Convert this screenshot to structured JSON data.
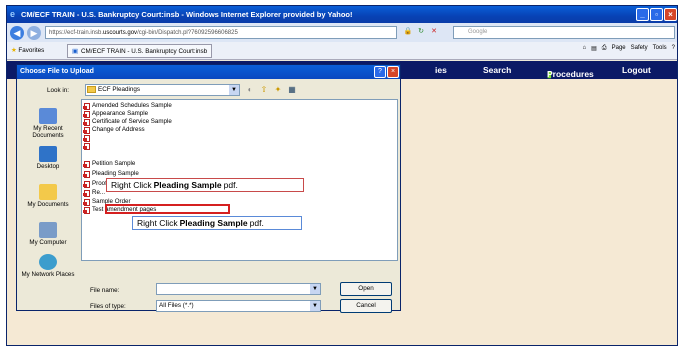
{
  "browser": {
    "title": "CM/ECF TRAIN - U.S. Bankruptcy Court:insb - Windows Internet Explorer provided by Yahoo!",
    "url_prefix": "https://ecf-train.insb.",
    "url_host": "uscourts.gov",
    "url_path": "/cgi-bin/Dispatch.pl?76092596606825",
    "search_placeholder": "Google",
    "favorites_label": "Favorites",
    "tab_label": "CM/ECF TRAIN - U.S. Bankruptcy Court:insb",
    "cmd_page": "Page",
    "cmd_safety": "Safety",
    "cmd_tools": "Tools"
  },
  "ecf_nav": {
    "items_label": "ies",
    "search": "Search",
    "procedures": "Procedures",
    "logout": "Logout"
  },
  "dialog": {
    "title": "Choose File to Upload",
    "look_in_label": "Look in:",
    "look_in_value": "ECF Pleadings",
    "places": [
      "My Recent Documents",
      "Desktop",
      "My Documents",
      "My Computer",
      "My Network Places"
    ],
    "files": [
      "Amended Schedules Sample",
      "Appearance Sample",
      "Certificate of Service Sample",
      "Change of Address",
      "",
      "",
      "Petition Sample",
      "Pleading Sample",
      "Proof of Claim Sample",
      "Re...",
      "Sample Order",
      "Test amendment pages"
    ],
    "file_name_label": "File name:",
    "file_name_value": "",
    "files_of_type_label": "Files of type:",
    "files_of_type_value": "All Files (*.*)",
    "open_button": "Open",
    "cancel_button": "Cancel"
  },
  "callouts": {
    "first_prefix": "Right Click",
    "first_bold": "Pleading Sample",
    "first_suffix": "pdf.",
    "second_prefix": "Right Click",
    "second_bold": "Pleading Sample",
    "second_suffix": "pdf."
  }
}
